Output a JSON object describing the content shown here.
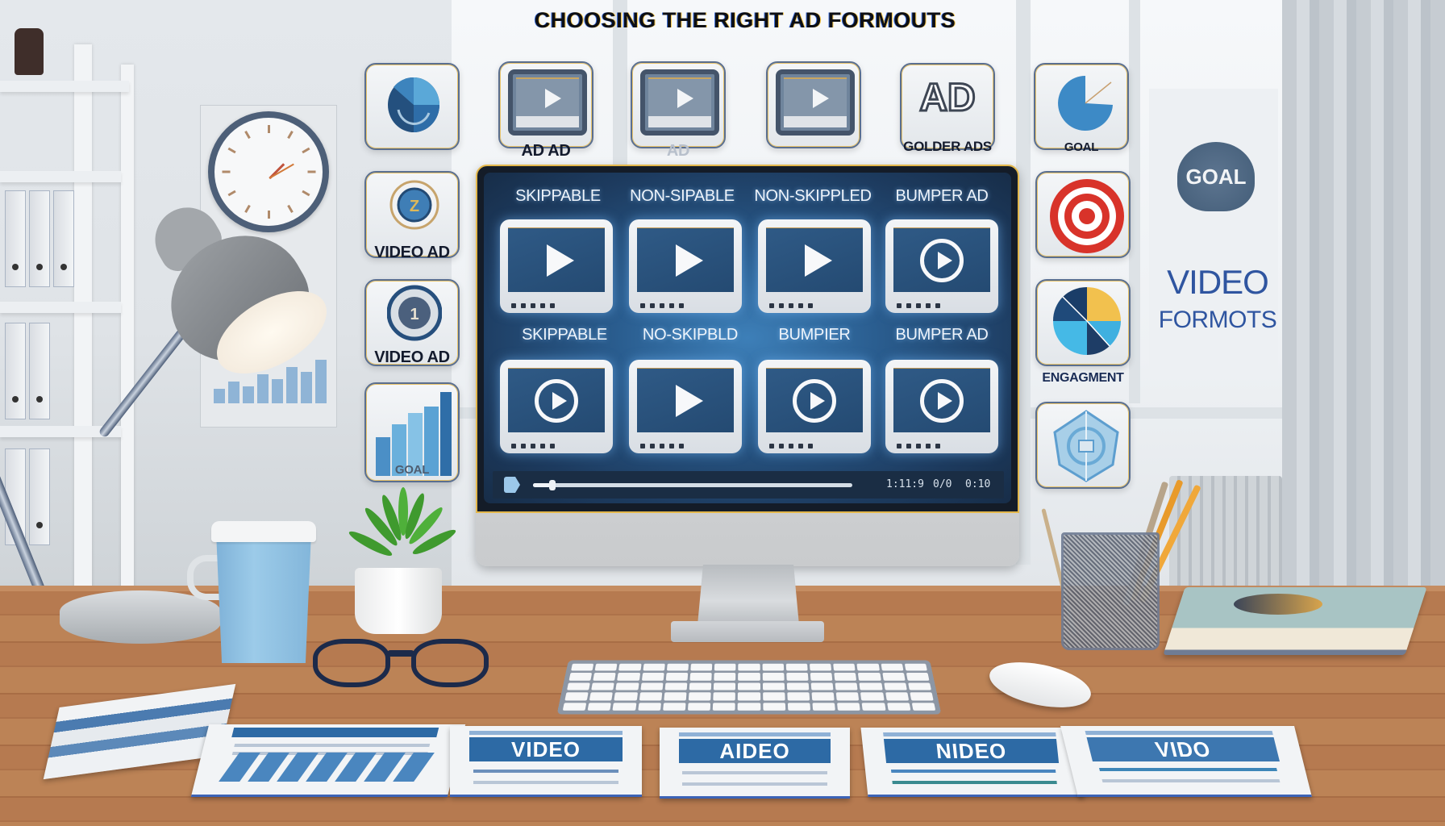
{
  "title": "CHOOSING THE RIGHT AD FORMOUTS",
  "top_icon_row": [
    {
      "icon": "pie-chart-icon",
      "label": ""
    },
    {
      "icon": "video-player-icon",
      "label": "AD AD"
    },
    {
      "icon": "video-player-icon",
      "label": "AD"
    },
    {
      "icon": "video-player-icon",
      "label": ""
    },
    {
      "icon": "ad-badge-icon",
      "label": "GOLDER ADS",
      "badge_text": "AD"
    },
    {
      "icon": "pie-chart-icon",
      "label": "GOAL"
    }
  ],
  "left_icon_column": [
    {
      "icon": "circular-badge-icon",
      "label": "VIDEO AD"
    },
    {
      "icon": "timer-badge-icon",
      "label": "VIDEO AD"
    },
    {
      "icon": "bar-chart-icon",
      "label": "GOAL"
    }
  ],
  "right_icon_column": [
    {
      "icon": "target-icon",
      "label": ""
    },
    {
      "icon": "pie-chart-icon",
      "label": "ENGAGMENT"
    },
    {
      "icon": "shield-badge-icon",
      "label": ""
    }
  ],
  "wall_sign": {
    "goal_badge": "GOAL",
    "line1": "VIDEO",
    "line2": "FORMOTS"
  },
  "monitor": {
    "row1": [
      {
        "label": "SKIPPABLE",
        "icon": "play-icon"
      },
      {
        "label": "NON-SIPABLE",
        "icon": "play-icon"
      },
      {
        "label": "NON-SKIPPLED",
        "icon": "play-icon"
      },
      {
        "label": "BUMPER AD",
        "icon": "play-circle-icon"
      }
    ],
    "row2": [
      {
        "label": "SKIPPABLE",
        "icon": "play-circle-icon"
      },
      {
        "label": "NO-SKIPBLD",
        "icon": "play-icon"
      },
      {
        "label": "BUMPIER",
        "icon": "play-circle-icon"
      },
      {
        "label": "BUMPER AD",
        "icon": "play-circle-icon"
      }
    ],
    "player": {
      "progress": 0.06,
      "time_labels": [
        "1:11:9",
        "0/0",
        "0:10"
      ]
    }
  },
  "desk_papers": [
    {
      "banner": ""
    },
    {
      "banner": "VIDEO"
    },
    {
      "banner": "AIDEO"
    },
    {
      "banner": "NIDEO"
    },
    {
      "banner": "VIDO"
    }
  ],
  "colors": {
    "screen_blue": "#2a5d8f",
    "accent_blue": "#2d6aa5",
    "target_red": "#d8332a",
    "pie_yellow": "#f2c14e",
    "desk_wood": "#b67a50"
  }
}
